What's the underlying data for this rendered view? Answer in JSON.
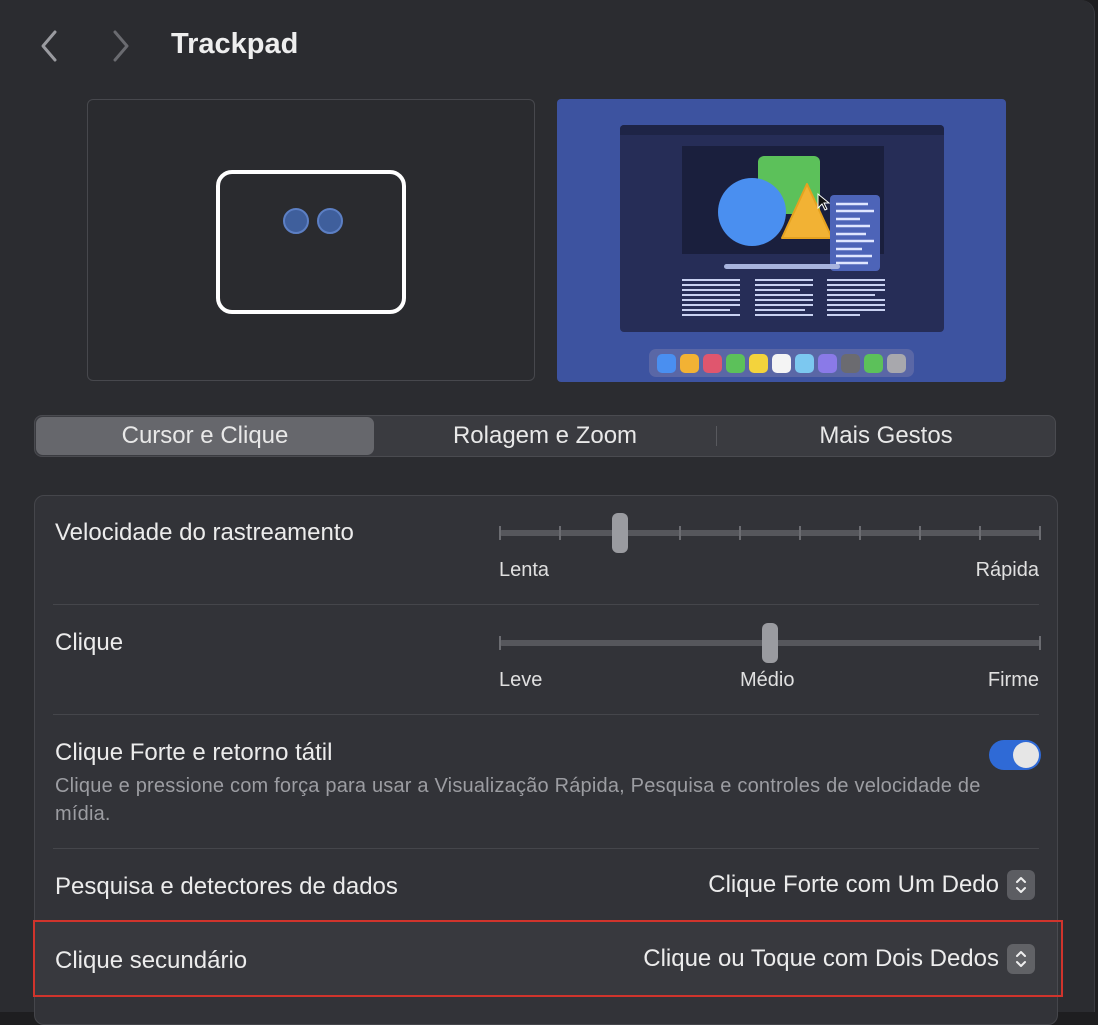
{
  "header": {
    "title": "Trackpad",
    "back_icon": "chevron-left-icon",
    "forward_icon": "chevron-right-icon"
  },
  "tabs": [
    {
      "label": "Cursor e Clique",
      "selected": true
    },
    {
      "label": "Rolagem e Zoom",
      "selected": false
    },
    {
      "label": "Mais Gestos",
      "selected": false
    }
  ],
  "settings": {
    "tracking_speed": {
      "label": "Velocidade do rastreamento",
      "min_label": "Lenta",
      "max_label": "Rápida",
      "steps": 10,
      "value_step": 3
    },
    "click": {
      "label": "Clique",
      "min_label": "Leve",
      "mid_label": "Médio",
      "max_label": "Firme",
      "steps": 3,
      "value_step": 2
    },
    "force_click": {
      "label": "Clique Forte e retorno tátil",
      "description": "Clique e pressione com força para usar a Visualização Rápida, Pesquisa e controles de velocidade de mídia.",
      "enabled": true
    },
    "lookup": {
      "label": "Pesquisa e detectores de dados",
      "value": "Clique Forte com Um Dedo"
    },
    "secondary_click": {
      "label": "Clique secundário",
      "value": "Clique ou Toque com Dois Dedos"
    }
  },
  "colors": {
    "accent": "#2f6ad6",
    "highlight_border": "#d0342c",
    "preview_bg": "#3d53a0"
  }
}
